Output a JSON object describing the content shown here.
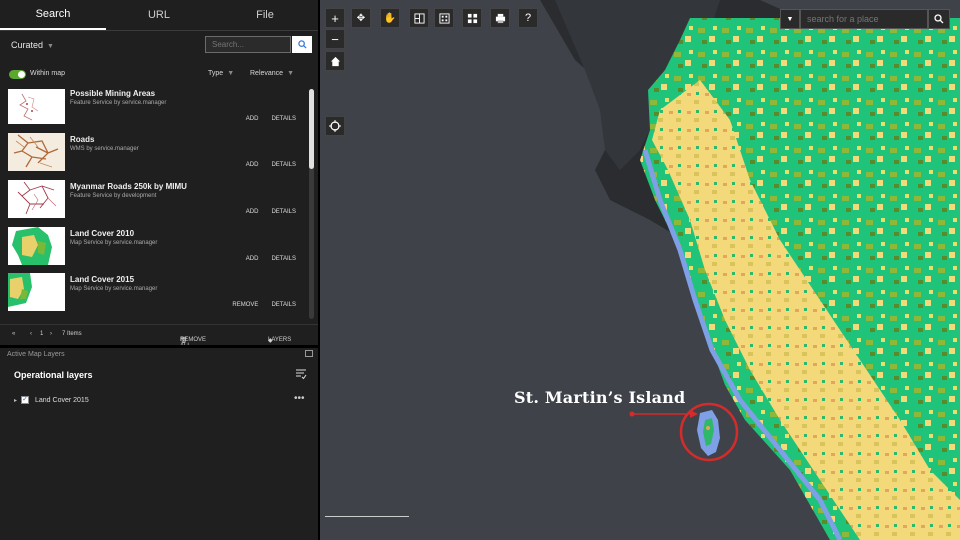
{
  "tabs": [
    "Search",
    "URL",
    "File"
  ],
  "search_panel": {
    "curated": "Curated",
    "search_placeholder": "Search...",
    "within_map": "Within map",
    "type_filter": "Type",
    "relevance_filter": "Relevance"
  },
  "results": [
    {
      "title": "Possible Mining Areas",
      "subtitle": "Feature Service by service.manager",
      "actions": [
        "ADD",
        "DETAILS"
      ],
      "thumb": "mining"
    },
    {
      "title": "Roads",
      "subtitle": "WMS by service.manager",
      "actions": [
        "ADD",
        "DETAILS"
      ],
      "thumb": "roads"
    },
    {
      "title": "Myanmar Roads 250k by MIMU",
      "subtitle": "Feature Service by development",
      "actions": [
        "ADD",
        "DETAILS"
      ],
      "thumb": "roads250"
    },
    {
      "title": "Land Cover 2010",
      "subtitle": "Map Service by service.manager",
      "actions": [
        "ADD",
        "DETAILS"
      ],
      "thumb": "landcover"
    },
    {
      "title": "Land Cover 2015",
      "subtitle": "Map Service by service.manager",
      "actions": [
        "REMOVE",
        "DETAILS"
      ],
      "thumb": "landcover"
    }
  ],
  "pager": {
    "page": "1",
    "items": "7 Items",
    "remove_all": "REMOVE ALL LAYERS",
    "layers": "LAYERS"
  },
  "active_layers": {
    "header": "Active Map Layers",
    "title": "Operational layers",
    "layers": [
      {
        "name": "Land Cover 2015",
        "checked": true
      }
    ]
  },
  "map": {
    "place_placeholder": "search for a place",
    "tool_icons": [
      "pan-icon",
      "hand-icon",
      "split-view-icon",
      "grid-view-icon",
      "layout-icon",
      "print-icon",
      "help-icon"
    ],
    "help_label": "?",
    "annotation": "St. Martin’s Island"
  },
  "colors": {
    "panel_bg": "#1f1f1f",
    "sea": "#3f4349",
    "landcover_forest": "#21c87a",
    "landcover_crop": "#f3d97a",
    "landcover_mixed": "#8db83a",
    "water": "#7fa0e6",
    "highlight": "#d62b2b",
    "toggle_on": "#5aa82f"
  }
}
